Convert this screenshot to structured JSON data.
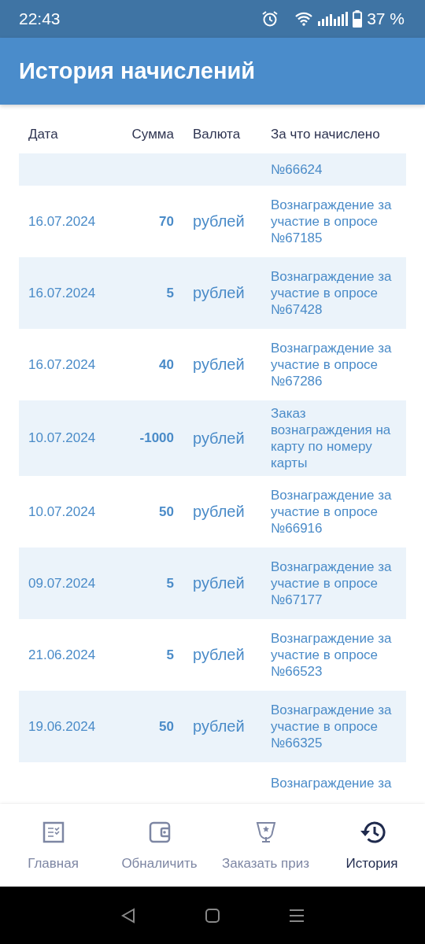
{
  "status_bar": {
    "time": "22:43",
    "battery": "37 %"
  },
  "app_bar": {
    "title": "История начислений"
  },
  "table": {
    "columns": [
      "Дата",
      "Сумма",
      "Валюта",
      "За что начислено"
    ],
    "rows": [
      {
        "kind": "cut-top",
        "description": "№66624"
      },
      {
        "date": "16.07.2024",
        "amount": "70",
        "currency": "рублей",
        "description": "Вознаграждение за участие в опросе №67185"
      },
      {
        "date": "16.07.2024",
        "amount": "5",
        "currency": "рублей",
        "description": "Вознаграждение за участие в опросе №67428"
      },
      {
        "date": "16.07.2024",
        "amount": "40",
        "currency": "рублей",
        "description": "Вознаграждение за участие в опросе №67286"
      },
      {
        "date": "10.07.2024",
        "amount": "-1000",
        "currency": "рублей",
        "description": "Заказ вознаграждения на карту по номеру карты"
      },
      {
        "date": "10.07.2024",
        "amount": "50",
        "currency": "рублей",
        "description": "Вознаграждение за участие в опросе №66916"
      },
      {
        "date": "09.07.2024",
        "amount": "5",
        "currency": "рублей",
        "description": "Вознаграждение за участие в опросе №67177"
      },
      {
        "date": "21.06.2024",
        "amount": "5",
        "currency": "рублей",
        "description": "Вознаграждение за участие в опросе №66523"
      },
      {
        "date": "19.06.2024",
        "amount": "50",
        "currency": "рублей",
        "description": "Вознаграждение за участие в опросе №66325"
      },
      {
        "kind": "cut-bottom",
        "description": "Вознаграждение за"
      }
    ]
  },
  "bottom_nav": [
    {
      "label": "Главная",
      "selected": false
    },
    {
      "label": "Обналичить",
      "selected": false
    },
    {
      "label": "Заказать приз",
      "selected": false
    },
    {
      "label": "История",
      "selected": true
    }
  ]
}
